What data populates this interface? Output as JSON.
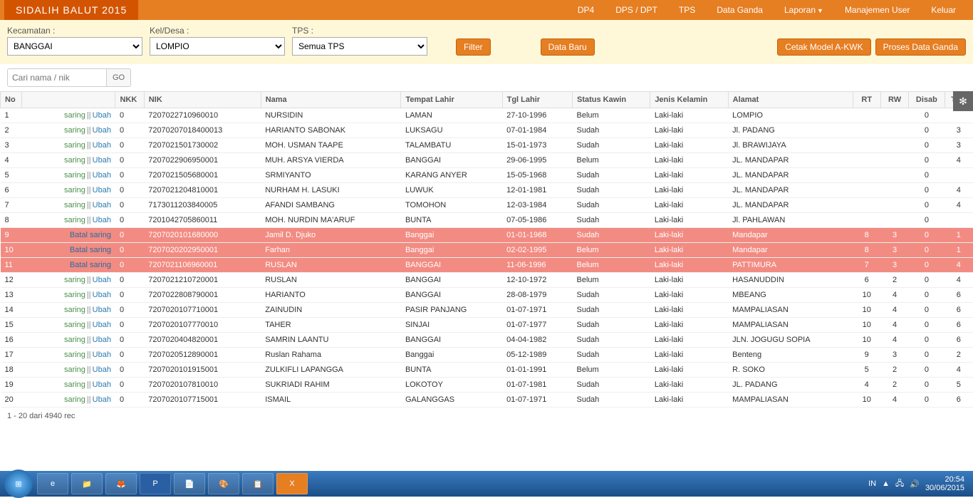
{
  "brand": "SIDALIH BALUT 2015",
  "nav": {
    "dp4": "DP4",
    "dps": "DPS / DPT",
    "tps": "TPS",
    "ganda": "Data Ganda",
    "laporan": "Laporan",
    "user": "Manajemen User",
    "keluar": "Keluar"
  },
  "filters": {
    "kecamatan_label": "Kecamatan :",
    "kecamatan_value": "BANGGAI",
    "keldesa_label": "Kel/Desa :",
    "keldesa_value": "LOMPIO",
    "tps_label": "TPS :",
    "tps_value": "Semua TPS",
    "btn_filter": "Filter",
    "btn_baru": "Data Baru",
    "btn_cetak": "Cetak Model A-KWK",
    "btn_proses": "Proses Data Ganda"
  },
  "search": {
    "placeholder": "Cari nama / nik",
    "go": "GO"
  },
  "headers": {
    "no": "No",
    "nkk": "NKK",
    "nik": "NIK",
    "nama": "Nama",
    "tl": "Tempat Lahir",
    "tgl": "Tgl Lahir",
    "sk": "Status Kawin",
    "jk": "Jenis Kelamin",
    "al": "Alamat",
    "rt": "RT",
    "rw": "RW",
    "dis": "Disab",
    "tps": "TPS"
  },
  "action": {
    "saring": "saring",
    "batal": "Batal saring",
    "ubah": "Ubah"
  },
  "rows": [
    {
      "no": 1,
      "hl": false,
      "nkk": "0",
      "nik": "7207022710960010",
      "nama": "NURSIDIN",
      "tl": "LAMAN",
      "tgl": "27-10-1996",
      "sk": "Belum",
      "jk": "Laki-laki",
      "al": "LOMPIO",
      "rt": "",
      "rw": "",
      "dis": "0",
      "tps": ""
    },
    {
      "no": 2,
      "hl": false,
      "nkk": "0",
      "nik": "72070207018400013",
      "nama": "HARIANTO SABONAK",
      "tl": "LUKSAGU",
      "tgl": "07-01-1984",
      "sk": "Sudah",
      "jk": "Laki-laki",
      "al": "Jl. PADANG",
      "rt": "",
      "rw": "",
      "dis": "0",
      "tps": "3"
    },
    {
      "no": 3,
      "hl": false,
      "nkk": "0",
      "nik": "7207021501730002",
      "nama": "MOH. USMAN TAAPE",
      "tl": "TALAMBATU",
      "tgl": "15-01-1973",
      "sk": "Sudah",
      "jk": "Laki-laki",
      "al": "Jl. BRAWIJAYA",
      "rt": "",
      "rw": "",
      "dis": "0",
      "tps": "3"
    },
    {
      "no": 4,
      "hl": false,
      "nkk": "0",
      "nik": "7207022906950001",
      "nama": "MUH. ARSYA VIERDA",
      "tl": "BANGGAI",
      "tgl": "29-06-1995",
      "sk": "Belum",
      "jk": "Laki-laki",
      "al": "JL. MANDAPAR",
      "rt": "",
      "rw": "",
      "dis": "0",
      "tps": "4"
    },
    {
      "no": 5,
      "hl": false,
      "nkk": "0",
      "nik": "7207021505680001",
      "nama": "SRMIYANTO",
      "tl": "KARANG ANYER",
      "tgl": "15-05-1968",
      "sk": "Sudah",
      "jk": "Laki-laki",
      "al": "JL. MANDAPAR",
      "rt": "",
      "rw": "",
      "dis": "0",
      "tps": ""
    },
    {
      "no": 6,
      "hl": false,
      "nkk": "0",
      "nik": "7207021204810001",
      "nama": "NURHAM H. LASUKI",
      "tl": "LUWUK",
      "tgl": "12-01-1981",
      "sk": "Sudah",
      "jk": "Laki-laki",
      "al": "JL. MANDAPAR",
      "rt": "",
      "rw": "",
      "dis": "0",
      "tps": "4"
    },
    {
      "no": 7,
      "hl": false,
      "nkk": "0",
      "nik": "7173011203840005",
      "nama": "AFANDI SAMBANG",
      "tl": "TOMOHON",
      "tgl": "12-03-1984",
      "sk": "Sudah",
      "jk": "Laki-laki",
      "al": "JL. MANDAPAR",
      "rt": "",
      "rw": "",
      "dis": "0",
      "tps": "4"
    },
    {
      "no": 8,
      "hl": false,
      "nkk": "0",
      "nik": "7201042705860011",
      "nama": "MOH. NURDIN MA'ARUF",
      "tl": "BUNTA",
      "tgl": "07-05-1986",
      "sk": "Sudah",
      "jk": "Laki-laki",
      "al": "Jl. PAHLAWAN",
      "rt": "",
      "rw": "",
      "dis": "0",
      "tps": ""
    },
    {
      "no": 9,
      "hl": true,
      "nkk": "0",
      "nik": "7207020101680000",
      "nama": "Jamil D. Djuko",
      "tl": "Banggai",
      "tgl": "01-01-1968",
      "sk": "Sudah",
      "jk": "Laki-laki",
      "al": "Mandapar",
      "rt": "8",
      "rw": "3",
      "dis": "0",
      "tps": "1"
    },
    {
      "no": 10,
      "hl": true,
      "nkk": "0",
      "nik": "7207020202950001",
      "nama": "Farhan",
      "tl": "Banggai",
      "tgl": "02-02-1995",
      "sk": "Belum",
      "jk": "Laki-laki",
      "al": "Mandapar",
      "rt": "8",
      "rw": "3",
      "dis": "0",
      "tps": "1"
    },
    {
      "no": 11,
      "hl": true,
      "nkk": "0",
      "nik": "7207021106960001",
      "nama": "RUSLAN",
      "tl": "BANGGAI",
      "tgl": "11-06-1996",
      "sk": "Belum",
      "jk": "Laki-laki",
      "al": "PATTIMURA",
      "rt": "7",
      "rw": "3",
      "dis": "0",
      "tps": "4"
    },
    {
      "no": 12,
      "hl": false,
      "nkk": "0",
      "nik": "7207021210720001",
      "nama": "RUSLAN",
      "tl": "BANGGAI",
      "tgl": "12-10-1972",
      "sk": "Belum",
      "jk": "Laki-laki",
      "al": "HASANUDDIN",
      "rt": "6",
      "rw": "2",
      "dis": "0",
      "tps": "4"
    },
    {
      "no": 13,
      "hl": false,
      "nkk": "0",
      "nik": "7207022808790001",
      "nama": "HARIANTO",
      "tl": "BANGGAI",
      "tgl": "28-08-1979",
      "sk": "Sudah",
      "jk": "Laki-laki",
      "al": "MBEANG",
      "rt": "10",
      "rw": "4",
      "dis": "0",
      "tps": "6"
    },
    {
      "no": 14,
      "hl": false,
      "nkk": "0",
      "nik": "7207020107710001",
      "nama": "ZAINUDIN",
      "tl": "PASIR PANJANG",
      "tgl": "01-07-1971",
      "sk": "Sudah",
      "jk": "Laki-laki",
      "al": "MAMPALIASAN",
      "rt": "10",
      "rw": "4",
      "dis": "0",
      "tps": "6"
    },
    {
      "no": 15,
      "hl": false,
      "nkk": "0",
      "nik": "7207020107770010",
      "nama": "TAHER",
      "tl": "SINJAI",
      "tgl": "01-07-1977",
      "sk": "Sudah",
      "jk": "Laki-laki",
      "al": "MAMPALIASAN",
      "rt": "10",
      "rw": "4",
      "dis": "0",
      "tps": "6"
    },
    {
      "no": 16,
      "hl": false,
      "nkk": "0",
      "nik": "7207020404820001",
      "nama": "SAMRIN LAANTU",
      "tl": "BANGGAI",
      "tgl": "04-04-1982",
      "sk": "Sudah",
      "jk": "Laki-laki",
      "al": "JLN. JOGUGU SOPIA",
      "rt": "10",
      "rw": "4",
      "dis": "0",
      "tps": "6"
    },
    {
      "no": 17,
      "hl": false,
      "nkk": "0",
      "nik": "7207020512890001",
      "nama": "Ruslan Rahama",
      "tl": "Banggai",
      "tgl": "05-12-1989",
      "sk": "Sudah",
      "jk": "Laki-laki",
      "al": "Benteng",
      "rt": "9",
      "rw": "3",
      "dis": "0",
      "tps": "2"
    },
    {
      "no": 18,
      "hl": false,
      "nkk": "0",
      "nik": "7207020101915001",
      "nama": "ZULKIFLI LAPANGGA",
      "tl": "BUNTA",
      "tgl": "01-01-1991",
      "sk": "Belum",
      "jk": "Laki-laki",
      "al": "R. SOKO",
      "rt": "5",
      "rw": "2",
      "dis": "0",
      "tps": "4"
    },
    {
      "no": 19,
      "hl": false,
      "nkk": "0",
      "nik": "7207020107810010",
      "nama": "SUKRIADI RAHIM",
      "tl": "LOKOTOY",
      "tgl": "01-07-1981",
      "sk": "Sudah",
      "jk": "Laki-laki",
      "al": "JL. PADANG",
      "rt": "4",
      "rw": "2",
      "dis": "0",
      "tps": "5"
    },
    {
      "no": 20,
      "hl": false,
      "nkk": "0",
      "nik": "7207020107715001",
      "nama": "ISMAIL",
      "tl": "GALANGGAS",
      "tgl": "01-07-1971",
      "sk": "Sudah",
      "jk": "Laki-laki",
      "al": "MAMPALIASAN",
      "rt": "10",
      "rw": "4",
      "dis": "0",
      "tps": "6"
    }
  ],
  "footer": "1 - 20 dari 4940 rec",
  "tray": {
    "lang": "IN",
    "time": "20:54",
    "date": "30/06/2015"
  }
}
